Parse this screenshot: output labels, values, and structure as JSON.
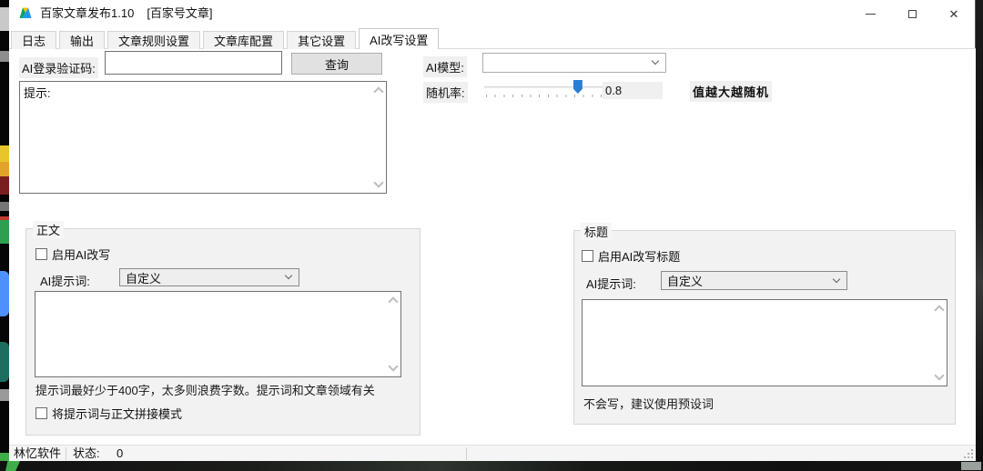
{
  "titlebar": {
    "title": "百家文章发布1.10",
    "subtitle": "[百家号文章]"
  },
  "tabs": [
    {
      "label": "日志",
      "active": false
    },
    {
      "label": "输出",
      "active": false
    },
    {
      "label": "文章规则设置",
      "active": false
    },
    {
      "label": "文章库配置",
      "active": false
    },
    {
      "label": "其它设置",
      "active": false
    },
    {
      "label": "AI改写设置",
      "active": true
    }
  ],
  "top_panel": {
    "captcha_label": "AI登录验证码:",
    "captcha_value": "",
    "query_button": "查询",
    "model_label": "AI模型:",
    "model_value": "",
    "random_label": "随机率:",
    "random_value": "0.8",
    "random_slider_percent": 76,
    "random_hint": "值越大越随机",
    "prompt_box_text": "提示:"
  },
  "body_group": {
    "title": "正文",
    "enable_label": "启用AI改写",
    "enable_checked": false,
    "prompt_label": "AI提示词:",
    "prompt_selected": "自定义",
    "prompt_value": "",
    "hint": "提示词最好少于400字，太多则浪费字数。提示词和文章领域有关",
    "concat_label": "将提示词与正文拼接模式",
    "concat_checked": false
  },
  "title_group": {
    "title": "标题",
    "enable_label": "启用AI改写标题",
    "enable_checked": false,
    "prompt_label": "AI提示词:",
    "prompt_selected": "自定义",
    "prompt_value": "",
    "hint": "不会写，建议使用预设词"
  },
  "statusbar": {
    "brand": "林忆软件",
    "status_label": "状态:",
    "status_value": "0"
  },
  "colors": {
    "accent_blue": "#2b7cd3",
    "window_bg": "#ffffff",
    "group_bg": "#f2f2f2",
    "control_border": "#717171"
  }
}
